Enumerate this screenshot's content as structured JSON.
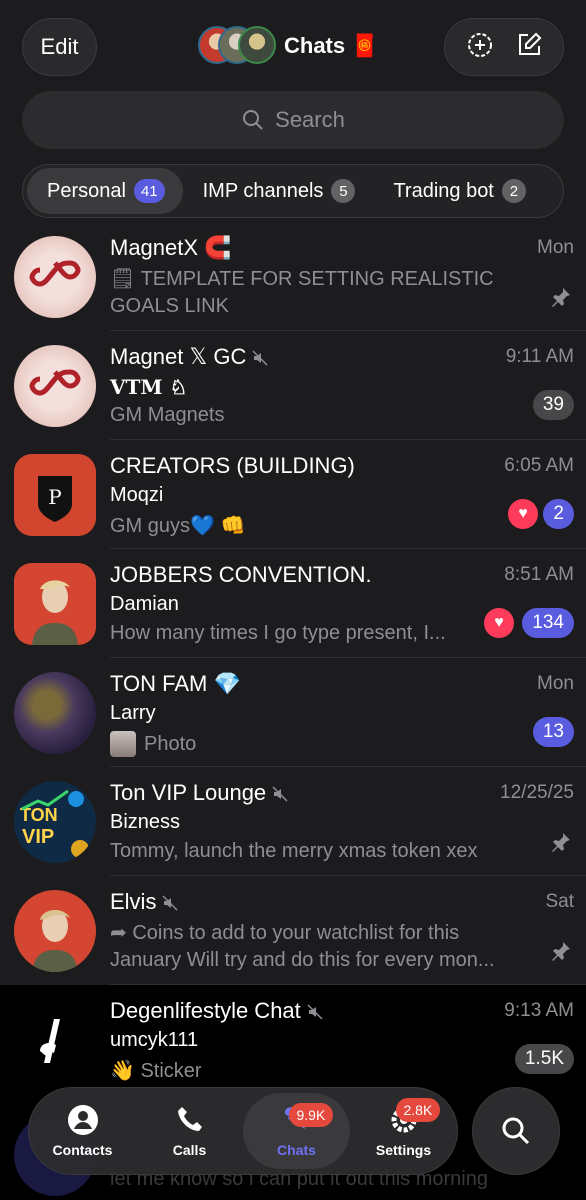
{
  "header": {
    "edit_label": "Edit",
    "title": "Chats",
    "title_emoji": "🧧"
  },
  "search": {
    "placeholder": "Search"
  },
  "folders": [
    {
      "label": "Personal",
      "count": "41"
    },
    {
      "label": "IMP channels",
      "count": "5"
    },
    {
      "label": "Trading bot",
      "count": "2"
    }
  ],
  "chats": [
    {
      "name": "MagnetX 🧲",
      "time": "Mon",
      "line2": "🗒 TEMPLATE FOR SETTING REALISTIC",
      "line3": "GOALS LINK",
      "pinned": true
    },
    {
      "name": "Magnet 𝕏 GC",
      "time": "9:11 AM",
      "line2": "𝐕𝐓𝐌 ♘",
      "line3": "GM Magnets",
      "badge": "39"
    },
    {
      "name": "CREATORS (BUILDING)",
      "time": "6:05 AM",
      "line2": "Moqzi",
      "line3": "GM guys💙 👊",
      "badge": "2"
    },
    {
      "name": "JOBBERS CONVENTION.",
      "time": "8:51 AM",
      "line2": "Damian",
      "line3": "How many times I go type present, I...",
      "badge": "134"
    },
    {
      "name": "TON FAM 💎",
      "time": "Mon",
      "line2": "Larry",
      "line3": "Photo",
      "badge": "13"
    },
    {
      "name": "Ton VIP Lounge",
      "time": "12/25/25",
      "line2": "Bizness",
      "line3": "Tommy, launch the merry xmas token xex",
      "pinned": true
    },
    {
      "name": "Elvis",
      "time": "Sat",
      "line2": "➦ Coins to add to your watchlist for this",
      "line3": "January Will try and do this for every mon...",
      "pinned": true
    },
    {
      "name": "Degenlifestyle Chat",
      "time": "9:13 AM",
      "line2": "umcyk111",
      "line3": "👋 Sticker",
      "badge": "1.5K"
    }
  ],
  "peek_text": "let me know so i can put it out this morning",
  "tabbar": [
    {
      "label": "Contacts"
    },
    {
      "label": "Calls"
    },
    {
      "label": "Chats",
      "badge": "9.9K"
    },
    {
      "label": "Settings",
      "badge": "2.8K"
    }
  ]
}
